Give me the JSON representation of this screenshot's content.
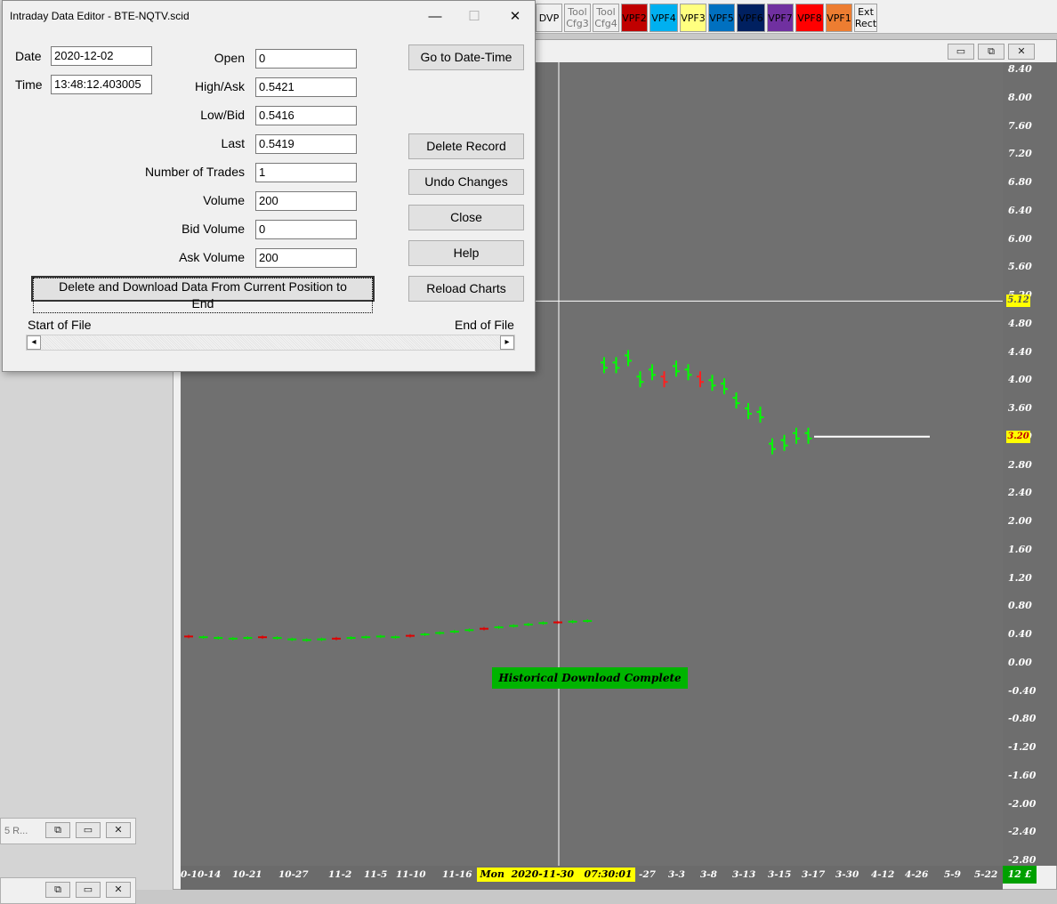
{
  "dialog": {
    "title": "Intraday Data Editor - BTE-NQTV.scid",
    "minimize": "—",
    "maximize": "☐",
    "close": "✕",
    "date_label": "Date",
    "date_value": "2020-12-02",
    "time_label": "Time",
    "time_value": "13:48:12.403005",
    "fields": [
      {
        "label": "Open",
        "value": "0"
      },
      {
        "label": "High/Ask",
        "value": "0.5421"
      },
      {
        "label": "Low/Bid",
        "value": "0.5416"
      },
      {
        "label": "Last",
        "value": "0.5419"
      },
      {
        "label": "Number of Trades",
        "value": "1"
      },
      {
        "label": "Volume",
        "value": "200"
      },
      {
        "label": "Bid Volume",
        "value": "0"
      },
      {
        "label": "Ask Volume",
        "value": "200"
      }
    ],
    "buttons": {
      "goto": "Go to Date-Time",
      "delete_record": "Delete  Record",
      "undo": "Undo Changes",
      "close": "Close",
      "help": "Help",
      "reload": "Reload Charts",
      "delete_download": "Delete and Download Data From Current Position to End"
    },
    "start_of_file": "Start of File",
    "end_of_file": "End of File",
    "scroll_left": "◂",
    "scroll_right": "▸"
  },
  "toolbar": {
    "items": [
      {
        "label": "DVP",
        "bg": "#f0f0f0",
        "fg": "#000000"
      },
      {
        "label": "Tool\nCfg3",
        "bg": "#f0f0f0",
        "fg": "#777777"
      },
      {
        "label": "Tool\nCfg4",
        "bg": "#f0f0f0",
        "fg": "#777777"
      },
      {
        "label": "VPF2",
        "bg": "#c00000",
        "fg": "#000000"
      },
      {
        "label": "VPF4",
        "bg": "#00b0f0",
        "fg": "#000000"
      },
      {
        "label": "VPF3",
        "bg": "#ffff80",
        "fg": "#000000"
      },
      {
        "label": "VPF5",
        "bg": "#0070c0",
        "fg": "#000000"
      },
      {
        "label": "VPF6",
        "bg": "#002060",
        "fg": "#000000"
      },
      {
        "label": "VPF7",
        "bg": "#7030a0",
        "fg": "#000000"
      },
      {
        "label": "VPF8",
        "bg": "#ff0000",
        "fg": "#000000"
      },
      {
        "label": "VPF1",
        "bg": "#ed7d31",
        "fg": "#000000"
      },
      {
        "label": "Ext\nRect",
        "bg": "#f0f0f0",
        "fg": "#000000"
      }
    ]
  },
  "left_windows": [
    {
      "title": "5 R...",
      "b1": "⧉",
      "b2": "▭",
      "b3": "✕"
    },
    {
      "title": "",
      "b1": "⧉",
      "b2": "▭",
      "b3": "✕"
    }
  ],
  "chart_window": {
    "b1": "▭",
    "b2": "⧉",
    "b3": "✕"
  },
  "chart": {
    "banner": "Historical Download Complete",
    "cursor_price": "5.12",
    "last_price": "3.20",
    "cursor_time": "Mon  2020-11-30   07:30:01",
    "corner_label": "12 £",
    "y_ticks": [
      "8.40",
      "8.00",
      "7.60",
      "7.20",
      "6.80",
      "6.40",
      "6.00",
      "5.60",
      "5.20",
      "4.80",
      "4.40",
      "4.00",
      "3.60",
      "3.20",
      "2.80",
      "2.40",
      "2.00",
      "1.60",
      "1.20",
      "0.80",
      "0.40",
      "0.00",
      "-0.40",
      "-0.80",
      "-1.20",
      "-1.60",
      "-2.00",
      "-2.40",
      "-2.80"
    ],
    "x_ticks": [
      "0-10-14",
      "10-21",
      "10-27",
      "11-2",
      "11-5",
      "11-10",
      "11-16",
      "-27",
      "3-3",
      "3-8",
      "3-13",
      "3-15",
      "3-17",
      "3-30",
      "4-12",
      "4-26",
      "5-9",
      "5-22"
    ]
  },
  "chart_data": {
    "type": "ohlc",
    "title": "",
    "xlabel": "",
    "ylabel": "",
    "ylim": [
      -2.8,
      8.4
    ],
    "series": [
      {
        "values_segment1_close": [
          0.37,
          0.36,
          0.35,
          0.34,
          0.35,
          0.36,
          0.35,
          0.33,
          0.32,
          0.33,
          0.34,
          0.35,
          0.36,
          0.37,
          0.36,
          0.38,
          0.4,
          0.42,
          0.44,
          0.46,
          0.48,
          0.5,
          0.52,
          0.54,
          0.56,
          0.57,
          0.58,
          0.59
        ]
      },
      {
        "values_segment2_close": [
          4.2,
          4.2,
          4.3,
          4.0,
          4.1,
          4.0,
          4.15,
          4.1,
          4.0,
          3.95,
          3.9,
          3.7,
          3.55,
          3.5,
          3.05,
          3.1,
          3.2,
          3.2
        ]
      }
    ]
  }
}
